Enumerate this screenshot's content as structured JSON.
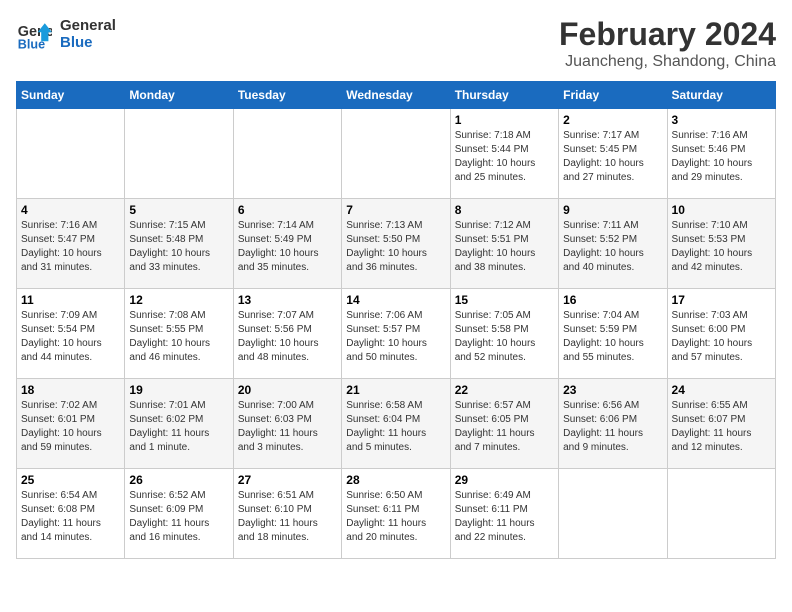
{
  "header": {
    "logo_line1": "General",
    "logo_line2": "Blue",
    "month_title": "February 2024",
    "location": "Juancheng, Shandong, China"
  },
  "days_of_week": [
    "Sunday",
    "Monday",
    "Tuesday",
    "Wednesday",
    "Thursday",
    "Friday",
    "Saturday"
  ],
  "weeks": [
    [
      {
        "day": "",
        "info": ""
      },
      {
        "day": "",
        "info": ""
      },
      {
        "day": "",
        "info": ""
      },
      {
        "day": "",
        "info": ""
      },
      {
        "day": "1",
        "info": "Sunrise: 7:18 AM\nSunset: 5:44 PM\nDaylight: 10 hours\nand 25 minutes."
      },
      {
        "day": "2",
        "info": "Sunrise: 7:17 AM\nSunset: 5:45 PM\nDaylight: 10 hours\nand 27 minutes."
      },
      {
        "day": "3",
        "info": "Sunrise: 7:16 AM\nSunset: 5:46 PM\nDaylight: 10 hours\nand 29 minutes."
      }
    ],
    [
      {
        "day": "4",
        "info": "Sunrise: 7:16 AM\nSunset: 5:47 PM\nDaylight: 10 hours\nand 31 minutes."
      },
      {
        "day": "5",
        "info": "Sunrise: 7:15 AM\nSunset: 5:48 PM\nDaylight: 10 hours\nand 33 minutes."
      },
      {
        "day": "6",
        "info": "Sunrise: 7:14 AM\nSunset: 5:49 PM\nDaylight: 10 hours\nand 35 minutes."
      },
      {
        "day": "7",
        "info": "Sunrise: 7:13 AM\nSunset: 5:50 PM\nDaylight: 10 hours\nand 36 minutes."
      },
      {
        "day": "8",
        "info": "Sunrise: 7:12 AM\nSunset: 5:51 PM\nDaylight: 10 hours\nand 38 minutes."
      },
      {
        "day": "9",
        "info": "Sunrise: 7:11 AM\nSunset: 5:52 PM\nDaylight: 10 hours\nand 40 minutes."
      },
      {
        "day": "10",
        "info": "Sunrise: 7:10 AM\nSunset: 5:53 PM\nDaylight: 10 hours\nand 42 minutes."
      }
    ],
    [
      {
        "day": "11",
        "info": "Sunrise: 7:09 AM\nSunset: 5:54 PM\nDaylight: 10 hours\nand 44 minutes."
      },
      {
        "day": "12",
        "info": "Sunrise: 7:08 AM\nSunset: 5:55 PM\nDaylight: 10 hours\nand 46 minutes."
      },
      {
        "day": "13",
        "info": "Sunrise: 7:07 AM\nSunset: 5:56 PM\nDaylight: 10 hours\nand 48 minutes."
      },
      {
        "day": "14",
        "info": "Sunrise: 7:06 AM\nSunset: 5:57 PM\nDaylight: 10 hours\nand 50 minutes."
      },
      {
        "day": "15",
        "info": "Sunrise: 7:05 AM\nSunset: 5:58 PM\nDaylight: 10 hours\nand 52 minutes."
      },
      {
        "day": "16",
        "info": "Sunrise: 7:04 AM\nSunset: 5:59 PM\nDaylight: 10 hours\nand 55 minutes."
      },
      {
        "day": "17",
        "info": "Sunrise: 7:03 AM\nSunset: 6:00 PM\nDaylight: 10 hours\nand 57 minutes."
      }
    ],
    [
      {
        "day": "18",
        "info": "Sunrise: 7:02 AM\nSunset: 6:01 PM\nDaylight: 10 hours\nand 59 minutes."
      },
      {
        "day": "19",
        "info": "Sunrise: 7:01 AM\nSunset: 6:02 PM\nDaylight: 11 hours\nand 1 minute."
      },
      {
        "day": "20",
        "info": "Sunrise: 7:00 AM\nSunset: 6:03 PM\nDaylight: 11 hours\nand 3 minutes."
      },
      {
        "day": "21",
        "info": "Sunrise: 6:58 AM\nSunset: 6:04 PM\nDaylight: 11 hours\nand 5 minutes."
      },
      {
        "day": "22",
        "info": "Sunrise: 6:57 AM\nSunset: 6:05 PM\nDaylight: 11 hours\nand 7 minutes."
      },
      {
        "day": "23",
        "info": "Sunrise: 6:56 AM\nSunset: 6:06 PM\nDaylight: 11 hours\nand 9 minutes."
      },
      {
        "day": "24",
        "info": "Sunrise: 6:55 AM\nSunset: 6:07 PM\nDaylight: 11 hours\nand 12 minutes."
      }
    ],
    [
      {
        "day": "25",
        "info": "Sunrise: 6:54 AM\nSunset: 6:08 PM\nDaylight: 11 hours\nand 14 minutes."
      },
      {
        "day": "26",
        "info": "Sunrise: 6:52 AM\nSunset: 6:09 PM\nDaylight: 11 hours\nand 16 minutes."
      },
      {
        "day": "27",
        "info": "Sunrise: 6:51 AM\nSunset: 6:10 PM\nDaylight: 11 hours\nand 18 minutes."
      },
      {
        "day": "28",
        "info": "Sunrise: 6:50 AM\nSunset: 6:11 PM\nDaylight: 11 hours\nand 20 minutes."
      },
      {
        "day": "29",
        "info": "Sunrise: 6:49 AM\nSunset: 6:11 PM\nDaylight: 11 hours\nand 22 minutes."
      },
      {
        "day": "",
        "info": ""
      },
      {
        "day": "",
        "info": ""
      }
    ]
  ]
}
